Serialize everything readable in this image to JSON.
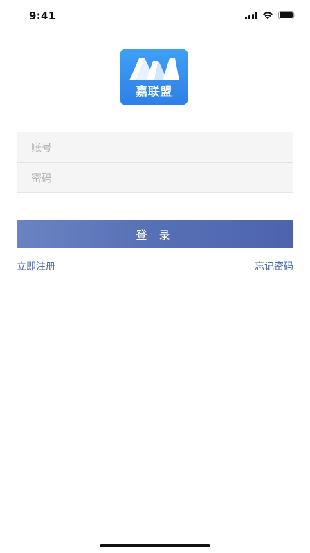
{
  "status_bar": {
    "time": "9:41"
  },
  "logo": {
    "text": "嘉联盟",
    "color": "#2f7fe6"
  },
  "form": {
    "account_placeholder": "账号",
    "password_placeholder": "密码"
  },
  "login_button": {
    "label": "登 录",
    "color": "#5670b5"
  },
  "links": {
    "register": "立即注册",
    "forgot_password": "忘记密码"
  }
}
